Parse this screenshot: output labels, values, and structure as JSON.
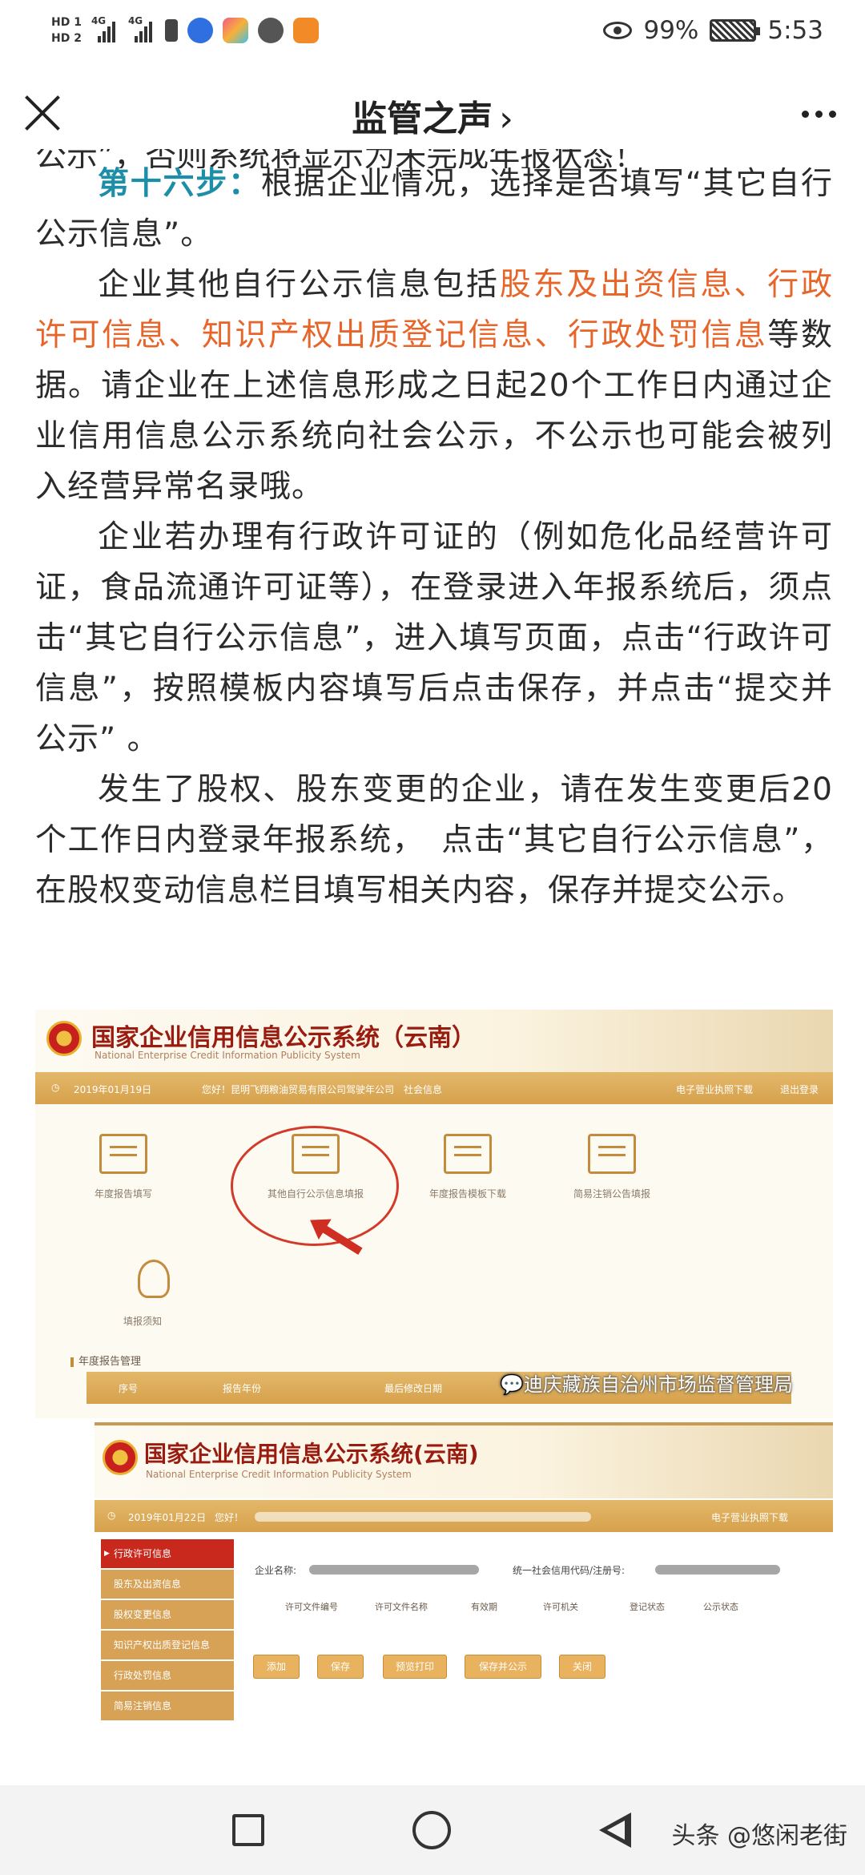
{
  "status_bar": {
    "hd1": "HD 1",
    "hd2": "HD 2",
    "net1": "4G",
    "net2": "4G",
    "battery_percent": "99%",
    "time": "5:53",
    "icons": [
      "eye-comfort-icon",
      "battery-icon",
      "music-app-icon",
      "gallery-app-icon",
      "browser-app-icon",
      "video-app-icon"
    ]
  },
  "title_bar": {
    "title": "监管之声",
    "chevron": "›"
  },
  "article": {
    "cut_line": "公示”，否则系统将显示为未完成年报状态！",
    "p1_step": "第十六步：",
    "p1_text": "根据企业情况，选择是否填写“其它自行公示信息”。",
    "p2_pre": "企业其他自行公示信息包括",
    "p2_highlight": "股东及出资信息、行政许可信息、知识产权出质登记信息、行政处罚信息",
    "p2_post": "等数据。请企业在上述信息形成之日起20个工作日内通过企业信用信息公示系统向社会公示，不公示也可能会被列入经营异常名录哦。",
    "p3": "企业若办理有行政许可证的（例如危化品经营许可证，食品流通许可证等），在登录进入年报系统后，须点击“其它自行公示信息”，进入填写页面，点击“行政许可信息”，按照模板内容填写后点击保存，并点击“提交并公示” 。",
    "p4": "发生了股权、股东变更的企业，请在发生变更后20个工作日内登录年报系统，　点击“其它自行公示信息”，在股权变动信息栏目填写相关内容，保存并提交公示。"
  },
  "screenshot1": {
    "title": "国家企业信用信息公示系统（云南）",
    "subtitle": "National Enterprise Credit Information Publicity System",
    "date": "2019年01月19日",
    "login_info": "您好！昆明飞翔粮油贸易有限公司驾驶年公司　社会信息",
    "top_right_1": "电子营业执照下载",
    "top_right_2": "退出登录",
    "tiles": [
      "年度报告填写",
      "其他自行公示信息填报",
      "年度报告模板下载",
      "简易注销公告填报"
    ],
    "bulb_label": "填报须知",
    "section": "年度报告管理",
    "table_headers": [
      "序号",
      "报告年份",
      "最后修改日期"
    ],
    "watermark": "迪庆藏族自治州市场监督管理局"
  },
  "screenshot2": {
    "title": "国家企业信用信息公示系统(云南)",
    "subtitle": "National Enterprise Credit Information Publicity System",
    "date": "2019年01月22日",
    "login_prefix": "您好！",
    "top_right": "电子营业执照下载",
    "sidebar": [
      "行政许可信息",
      "股东及出资信息",
      "股权变更信息",
      "知识产权出质登记信息",
      "行政处罚信息",
      "简易注销信息"
    ],
    "company_label": "企业名称:",
    "credit_label": "统一社会信用代码/注册号:",
    "columns": [
      "许可文件编号",
      "许可文件名称",
      "有效期",
      "许可机关",
      "登记状态",
      "公示状态"
    ],
    "buttons": [
      "添加",
      "保存",
      "预览打印",
      "保存并公示",
      "关闭"
    ]
  },
  "nav_bar": {
    "source": "头条 @悠闲老街"
  }
}
